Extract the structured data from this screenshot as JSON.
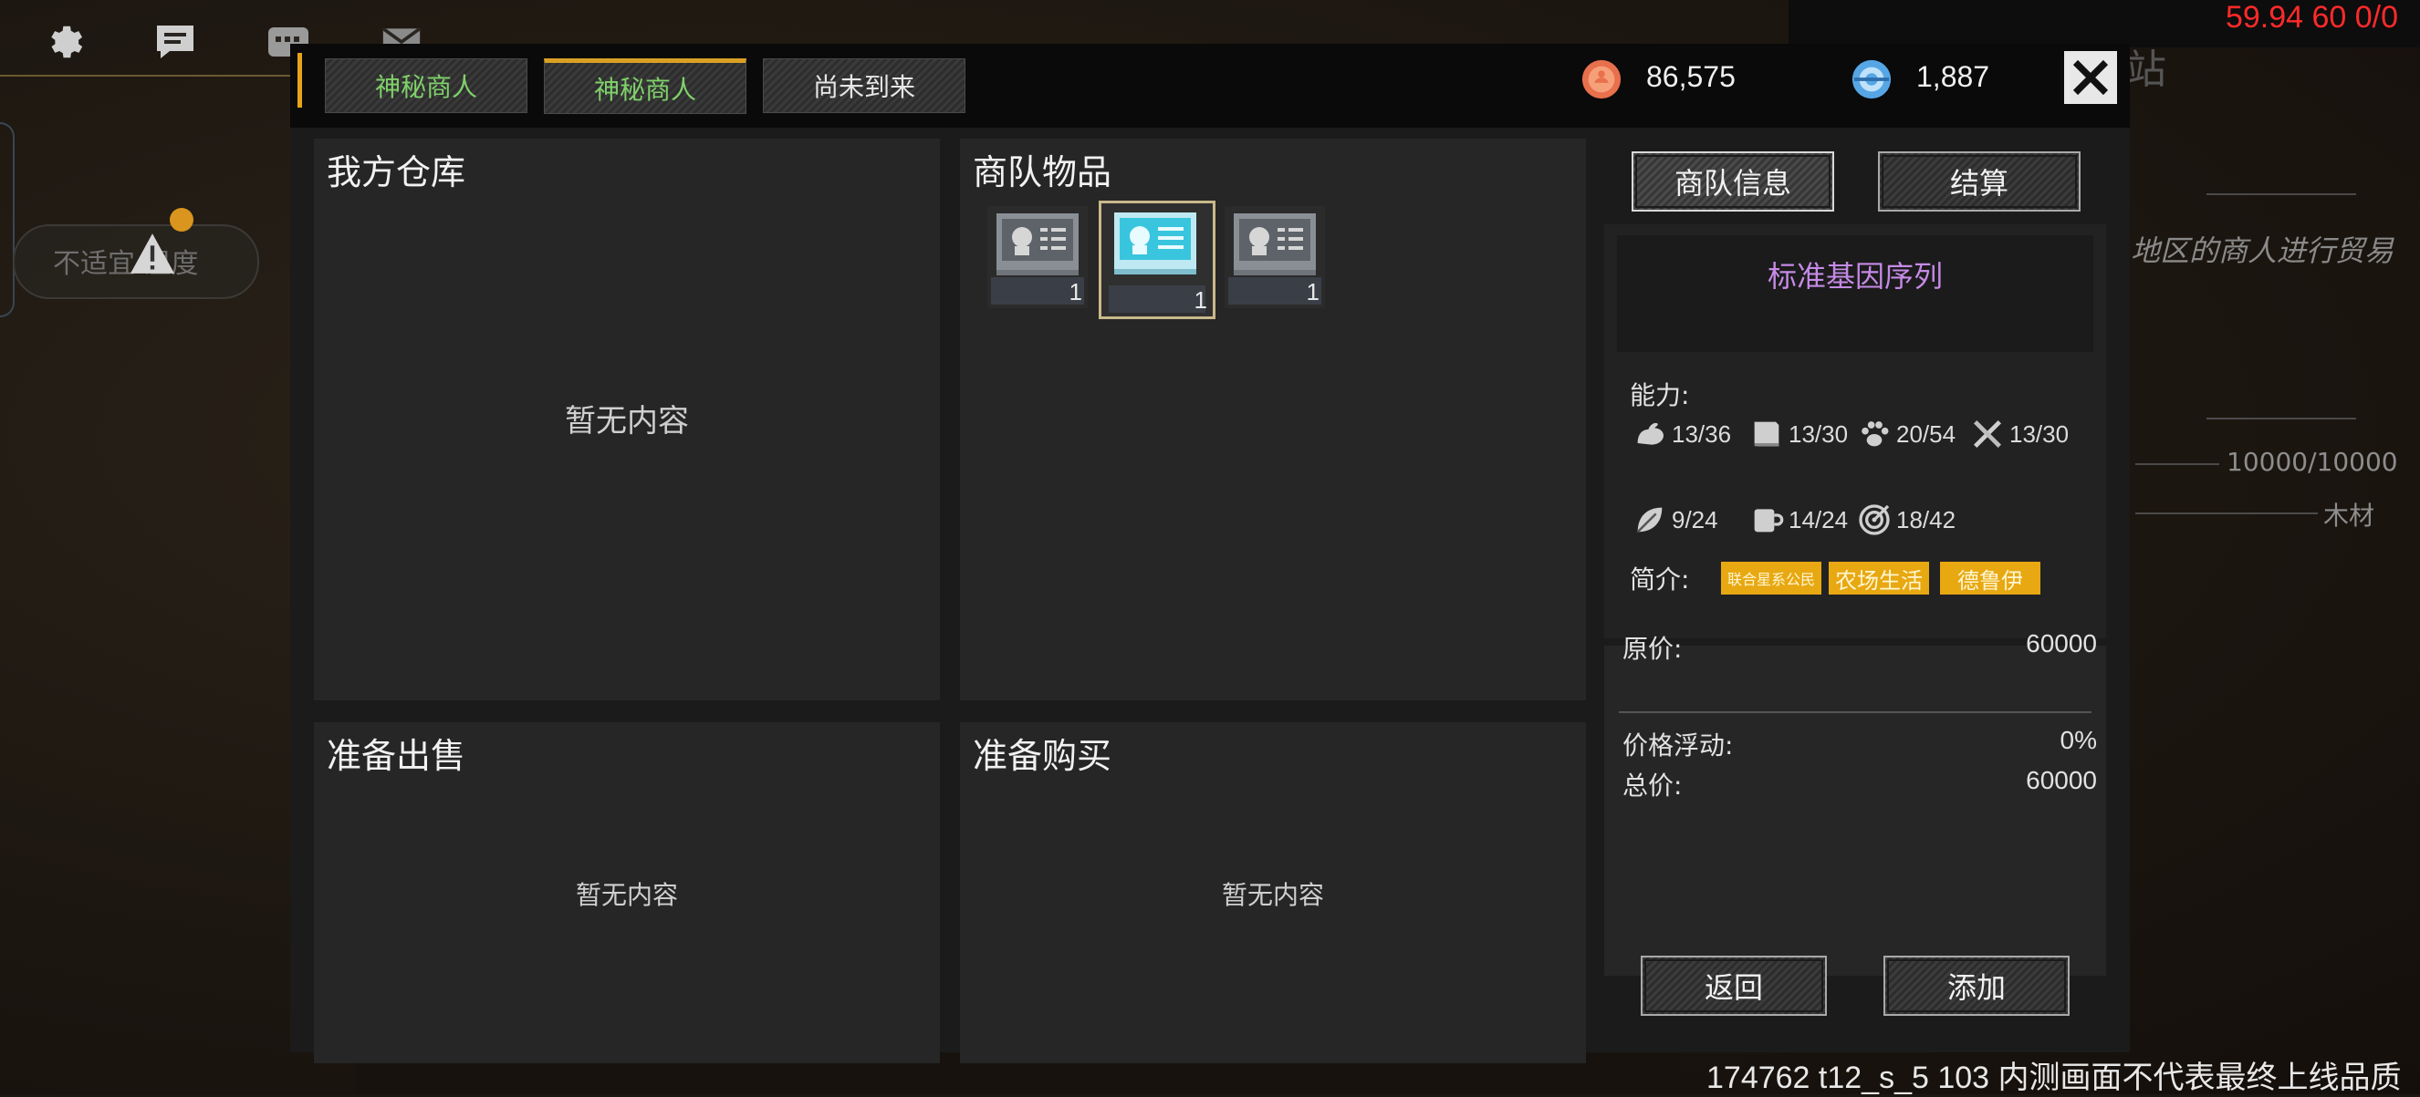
{
  "debug": {
    "fps_text": "59.94 60 0/0",
    "build_text": "174762 t12_s_5 103  内测画面不代表最终上线品质"
  },
  "background": {
    "warning_text": "不适宜 温度",
    "station_text": "站",
    "trade_text": "地区的商人进行贸易",
    "resource_count": "10000/10000",
    "resource_name": "木材",
    "top_icons": [
      "gear-icon",
      "chat-icon",
      "message-icon",
      "mail-icon"
    ]
  },
  "dialog": {
    "tabs": [
      {
        "label": "神秘商人",
        "active": false,
        "color": "#7fd16a"
      },
      {
        "label": "神秘商人",
        "active": true,
        "color": "#7fd16a"
      },
      {
        "label": "尚未到来",
        "active": false,
        "color": "#e6e6e6"
      }
    ],
    "currency": {
      "coins": "86,575",
      "gems": "1,887"
    },
    "panels": {
      "my_warehouse": {
        "title": "我方仓库",
        "empty": "暂无内容"
      },
      "caravan_items": {
        "title": "商队物品",
        "items": [
          {
            "icon": "gene-sequence-grey-icon",
            "count": "1",
            "selected": false
          },
          {
            "icon": "gene-sequence-blue-icon",
            "count": "1",
            "selected": true
          },
          {
            "icon": "gene-sequence-grey-icon",
            "count": "1",
            "selected": false
          }
        ]
      },
      "prepare_sell": {
        "title": "准备出售",
        "empty": "暂无内容"
      },
      "prepare_buy": {
        "title": "准备购买",
        "empty": "暂无内容"
      }
    },
    "info": {
      "caravan_info_button": "商队信息",
      "checkout_button": "结算",
      "item_name": "标准基因序列",
      "item_name_color": "#c58ae6",
      "abilities_label": "能力:",
      "abilities": [
        {
          "icon": "strength-arm-icon",
          "value": "13/36"
        },
        {
          "icon": "book-icon",
          "value": "13/30"
        },
        {
          "icon": "paw-icon",
          "value": "20/54"
        },
        {
          "icon": "tools-icon",
          "value": "13/30"
        },
        {
          "icon": "leaf-icon",
          "value": "9/24"
        },
        {
          "icon": "mug-icon",
          "value": "14/24"
        },
        {
          "icon": "target-icon",
          "value": "18/42"
        }
      ],
      "intro_label": "简介:",
      "tags": [
        "联合星系公民",
        "农场生活",
        "德鲁伊"
      ],
      "original_price_label": "原价:",
      "original_price": "60000",
      "price_float_label": "价格浮动:",
      "price_float": "0%",
      "total_label": "总价:",
      "total_price": "60000",
      "back_button": "返回",
      "add_button": "添加"
    }
  }
}
